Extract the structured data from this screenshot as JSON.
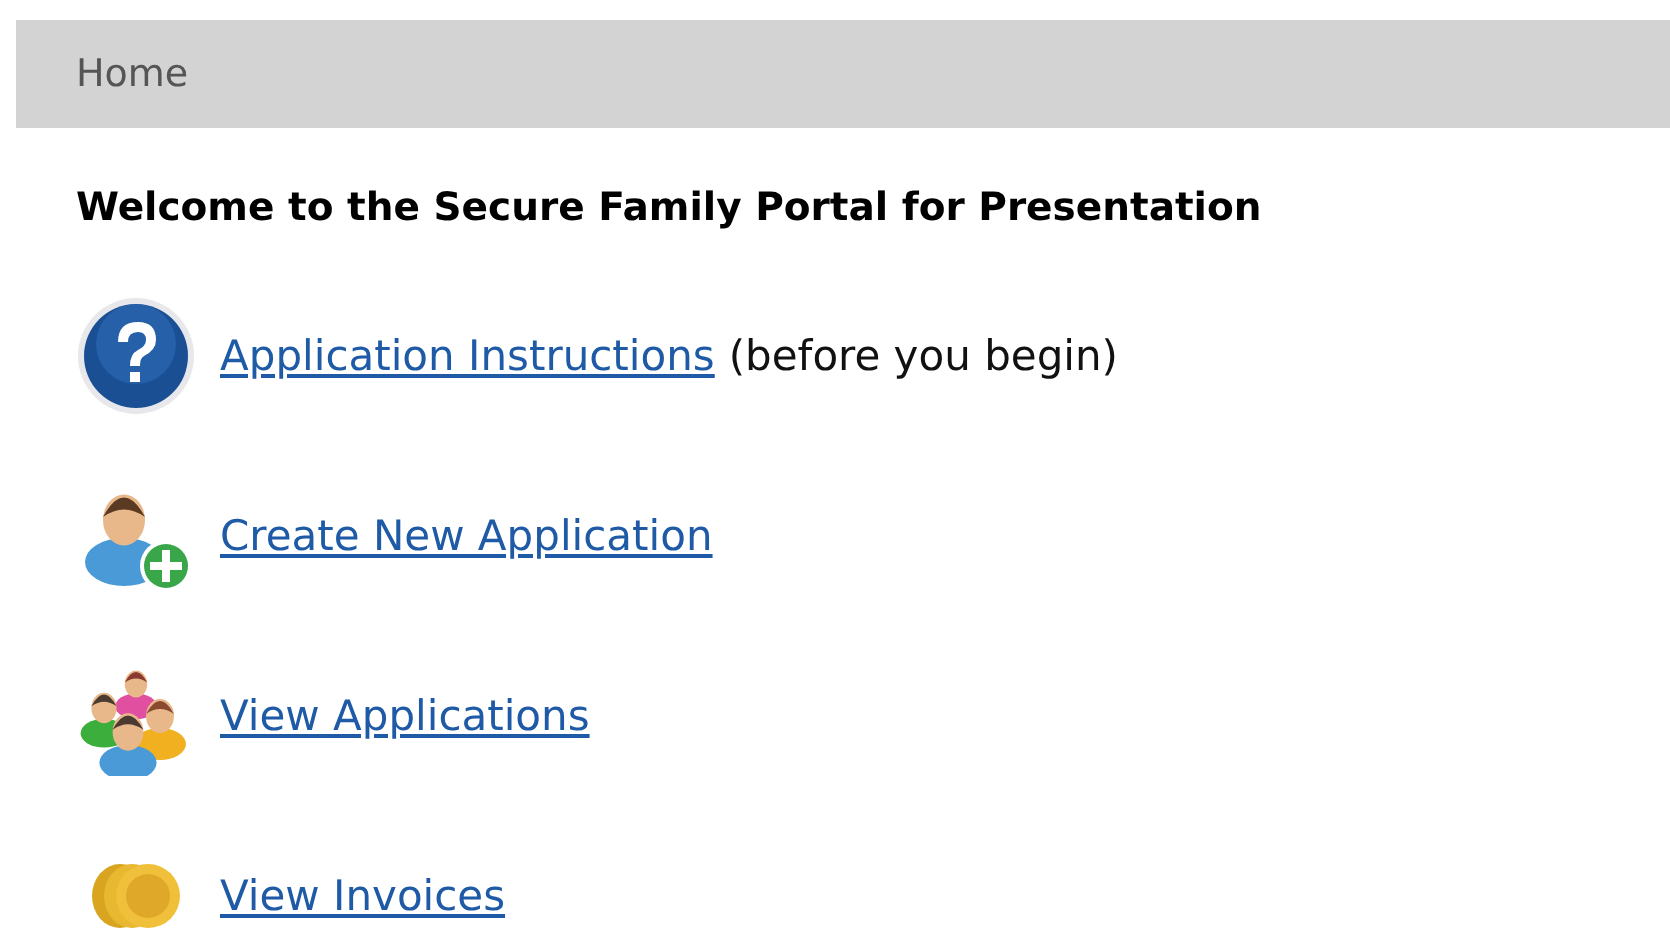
{
  "breadcrumb": {
    "label": "Home"
  },
  "heading": "Welcome to the Secure Family Portal for Presentation",
  "links": [
    {
      "kind": "help",
      "label": "Application Instructions",
      "note": "(before you begin)"
    },
    {
      "kind": "add-person",
      "label": "Create New Application"
    },
    {
      "kind": "group",
      "label": "View Applications"
    },
    {
      "kind": "coins",
      "label": "View Invoices"
    }
  ]
}
